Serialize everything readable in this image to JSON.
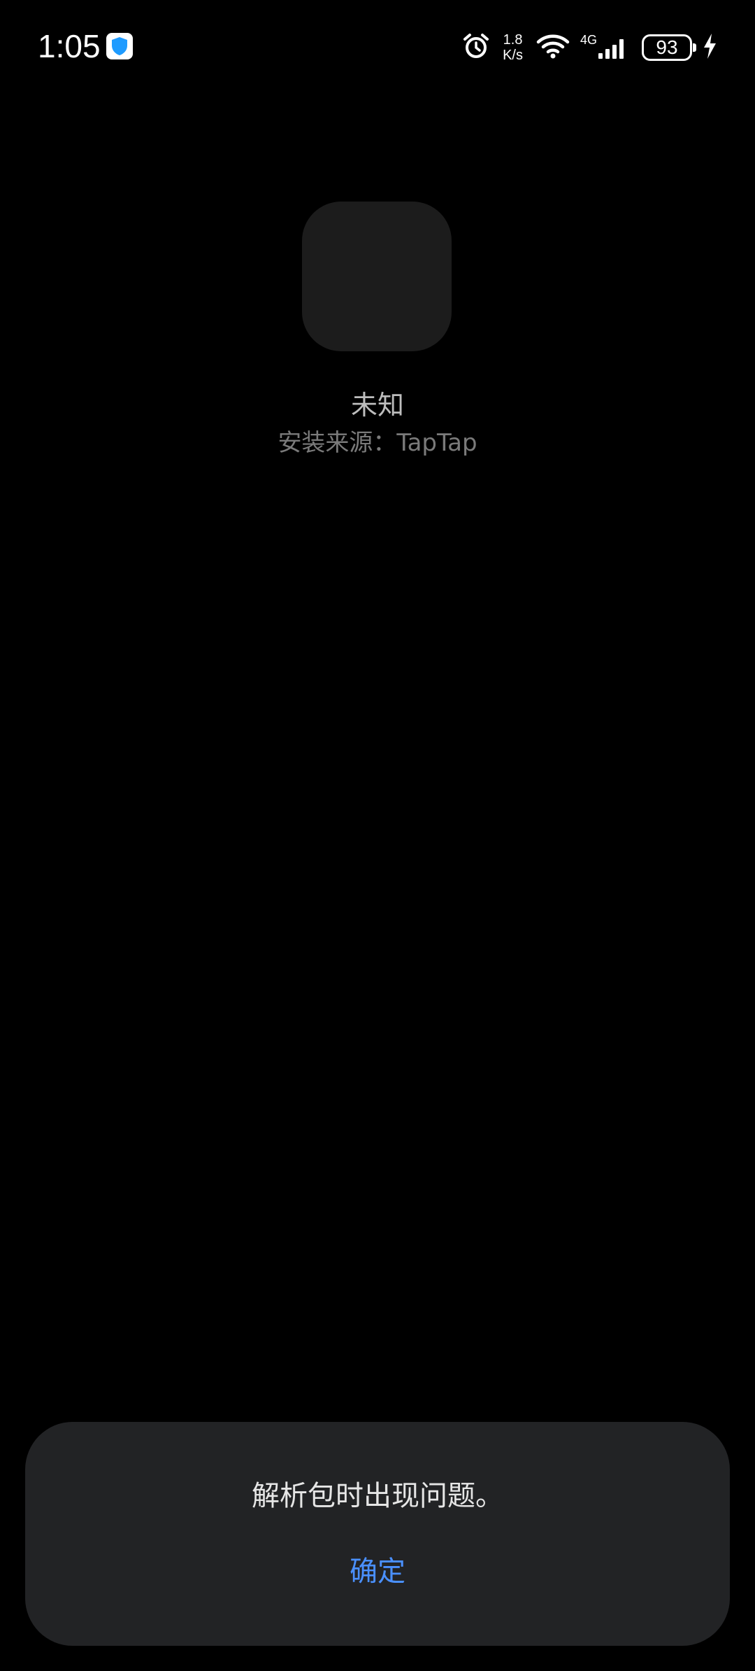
{
  "status_bar": {
    "time": "1:05",
    "net_speed_value": "1.8",
    "net_speed_unit": "K/s",
    "network_type": "4G",
    "battery_level": "93",
    "icons": [
      "shield-icon",
      "alarm-icon",
      "wifi-icon",
      "signal-icon",
      "battery-icon",
      "charging-icon"
    ]
  },
  "app": {
    "name": "未知",
    "install_source": "安装来源：TapTap"
  },
  "dialog": {
    "message": "解析包时出现问题。",
    "confirm_label": "确定"
  },
  "colors": {
    "background": "#000000",
    "dialog_background": "#222325",
    "accent": "#4a90ff",
    "shield": "#1e9bff"
  }
}
